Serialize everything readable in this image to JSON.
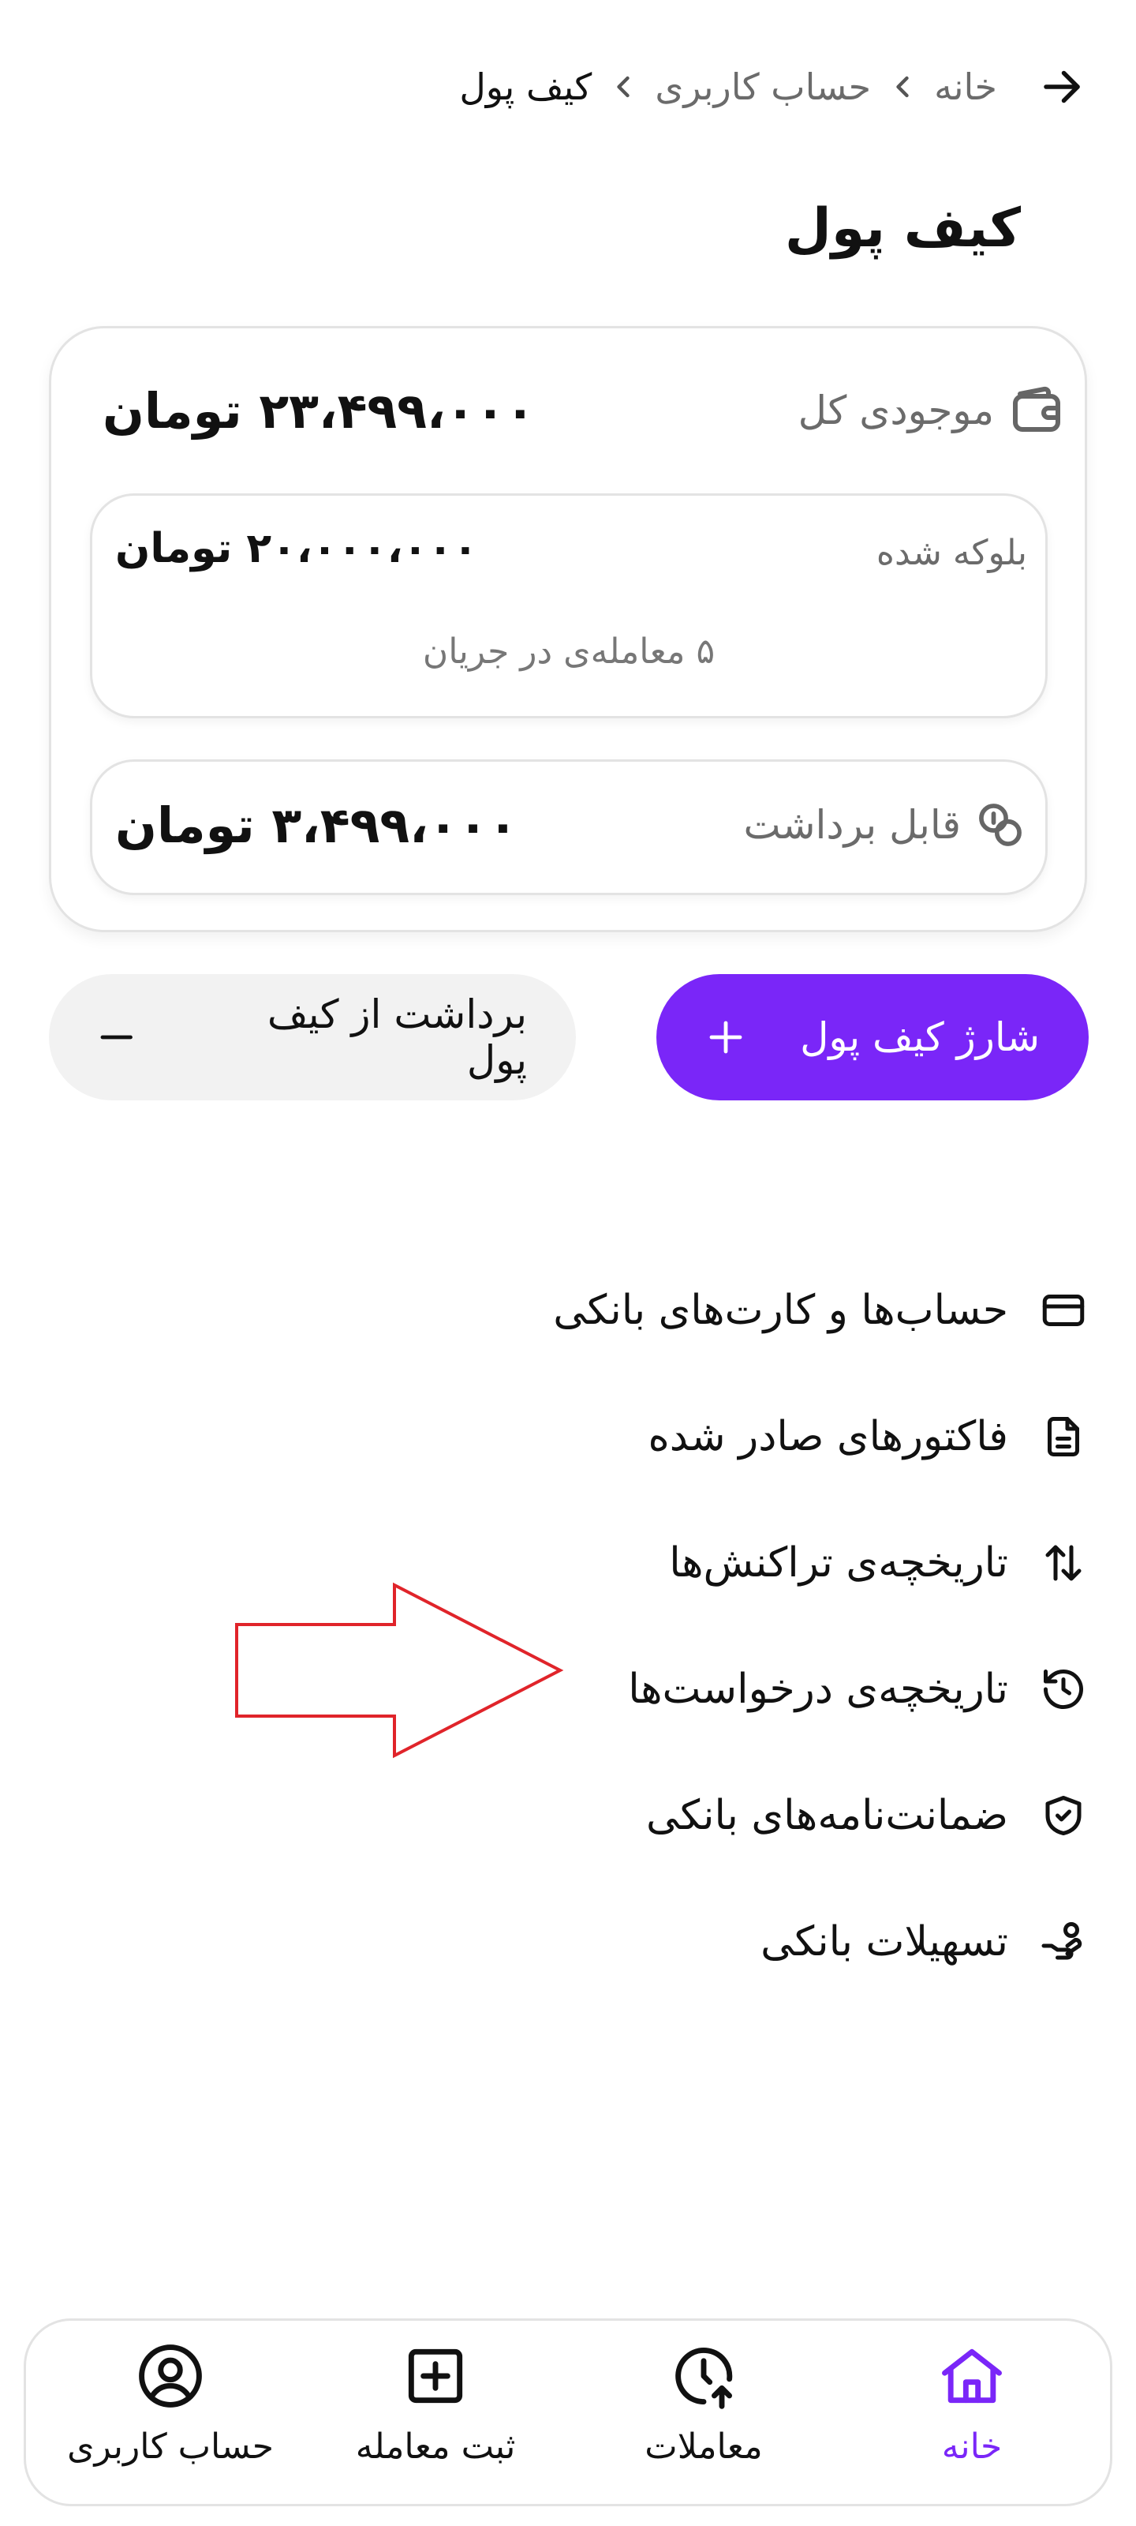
{
  "breadcrumb": {
    "items": [
      "خانه",
      "حساب کاربری",
      "کیف پول"
    ]
  },
  "page": {
    "title": "کیف پول"
  },
  "wallet": {
    "total_label": "موجودی کل",
    "total_amount": "۲۳،۴۹۹،۰۰۰ تومان",
    "blocked_label": "بلوکه شده",
    "blocked_amount": "۲۰،۰۰۰،۰۰۰ تومان",
    "blocked_note": "۵ معامله‌ی در جریان",
    "withdrawable_label": "قابل برداشت",
    "withdrawable_amount": "۳،۴۹۹،۰۰۰ تومان"
  },
  "actions": {
    "charge_label": "شارژ کیف پول",
    "withdraw_label": "برداشت از کیف پول"
  },
  "menu": {
    "items": [
      {
        "label": "حساب‌ها و کارت‌های بانکی",
        "icon": "credit-card-icon"
      },
      {
        "label": "فاکتورهای صادر شده",
        "icon": "document-icon"
      },
      {
        "label": "تاریخچه‌ی تراکنش‌ها",
        "icon": "transfer-arrows-icon"
      },
      {
        "label": "تاریخچه‌ی درخواست‌ها",
        "icon": "history-clock-icon"
      },
      {
        "label": "ضمانت‌نامه‌های بانکی",
        "icon": "shield-check-icon"
      },
      {
        "label": "تسهیلات بانکی",
        "icon": "hand-coin-icon"
      }
    ]
  },
  "bottom_nav": {
    "items": [
      {
        "label": "خانه",
        "icon": "home-icon",
        "active": true
      },
      {
        "label": "معاملات",
        "icon": "clock-upload-icon",
        "active": false
      },
      {
        "label": "ثبت معامله",
        "icon": "plus-square-icon",
        "active": false
      },
      {
        "label": "حساب کاربری",
        "icon": "user-circle-icon",
        "active": false
      }
    ]
  },
  "colors": {
    "accent": "#7a26f8",
    "annotation_arrow": "#e0242a",
    "muted_text": "#6b6b6b",
    "border": "#e3e3e3",
    "secondary_button_bg": "#f2f2f2"
  }
}
